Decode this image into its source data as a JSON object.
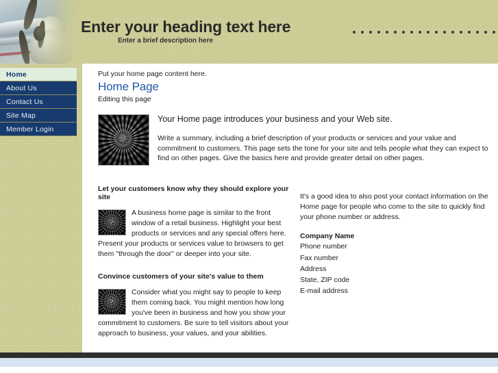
{
  "banner": {
    "heading": "Enter your heading text here",
    "description": "Enter a brief description here",
    "dot_count": 19,
    "background_color": "#cdcc96",
    "photo_alt": "airplane-propeller-photo"
  },
  "sidebar": {
    "items": [
      {
        "label": "Home",
        "active": true
      },
      {
        "label": "About Us",
        "active": false
      },
      {
        "label": "Contact Us",
        "active": false
      },
      {
        "label": "Site Map",
        "active": false
      },
      {
        "label": "Member Login",
        "active": false
      }
    ],
    "active_bg": "#dfeedd",
    "item_bg": "#173b6e",
    "item_text_color": "#e9eef4"
  },
  "content": {
    "top_note": "Put your home page content here.",
    "page_title": "Home Page",
    "editing_note": "Editing this page",
    "intro": {
      "lead": "Your Home page introduces your business and your Web site.",
      "body": "Write a summary, including a brief description of your products or services and your value and commitment to customers. This page sets the tone for your site and tells people what they can expect to find on other pages. Give the basics here and provide greater detail on other pages.",
      "image_name": "gears-clock-thumbnail"
    },
    "left_column": {
      "heading_1": "Let your customers know why they should explore your site",
      "body_1": "A business home page is similar to the front window of a retail business. Highlight your best products or services and any special offers here. Present your products or services value to browsers to get them \"through the door\" or deeper into your site.",
      "heading_2": "Convince customers of your site's value to them",
      "body_2": "Consider what you might say to people to keep them coming back. You might mention how long you've been in business and how you show your commitment to customers. Be sure to tell visitors about your approach to business, your values, and your abilities."
    },
    "right_column": {
      "paragraph": "It's a good idea to also post your contact information on the Home page for people who come to the site to quickly find your phone number or address.",
      "company_name": "Company Name",
      "contact_lines": [
        "Phone number",
        "Fax number",
        "Address",
        "State, ZIP code",
        "E-mail address"
      ]
    }
  },
  "footer": {
    "dark_bar_color": "#2f2f2f",
    "blue_bar_color": "#d7e3f0"
  }
}
